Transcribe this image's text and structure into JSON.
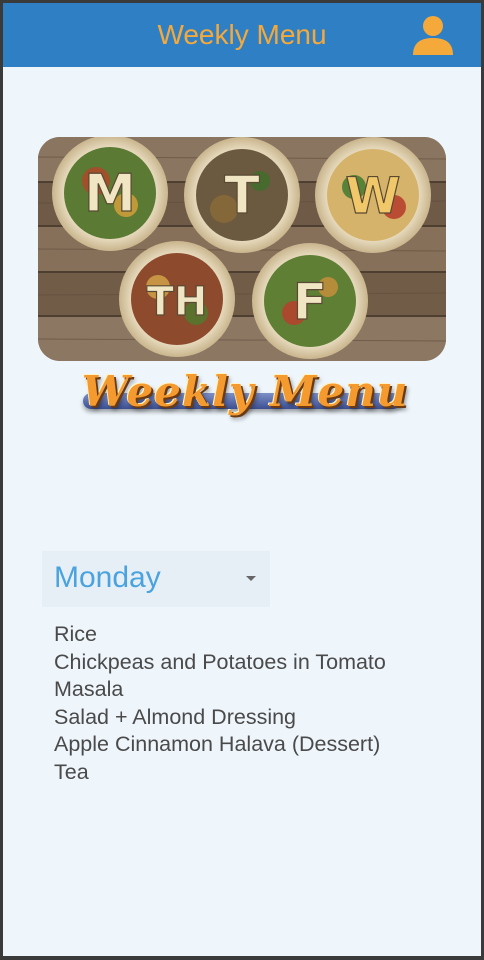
{
  "header": {
    "title": "Weekly Menu",
    "icon": "user-icon",
    "accent_color": "#f5a93b",
    "bar_color": "#2f7fc4"
  },
  "banner": {
    "letters": [
      "M",
      "T",
      "W",
      "TH",
      "F"
    ]
  },
  "logo": {
    "text": "Weekly Menu"
  },
  "day_selector": {
    "selected": "Monday",
    "icon": "caret-down-icon"
  },
  "menu_items": [
    "Rice",
    "Chickpeas and Potatoes in Tomato",
    "Masala",
    "Salad + Almond Dressing",
    "Apple Cinnamon Halava (Dessert)",
    "Tea"
  ]
}
